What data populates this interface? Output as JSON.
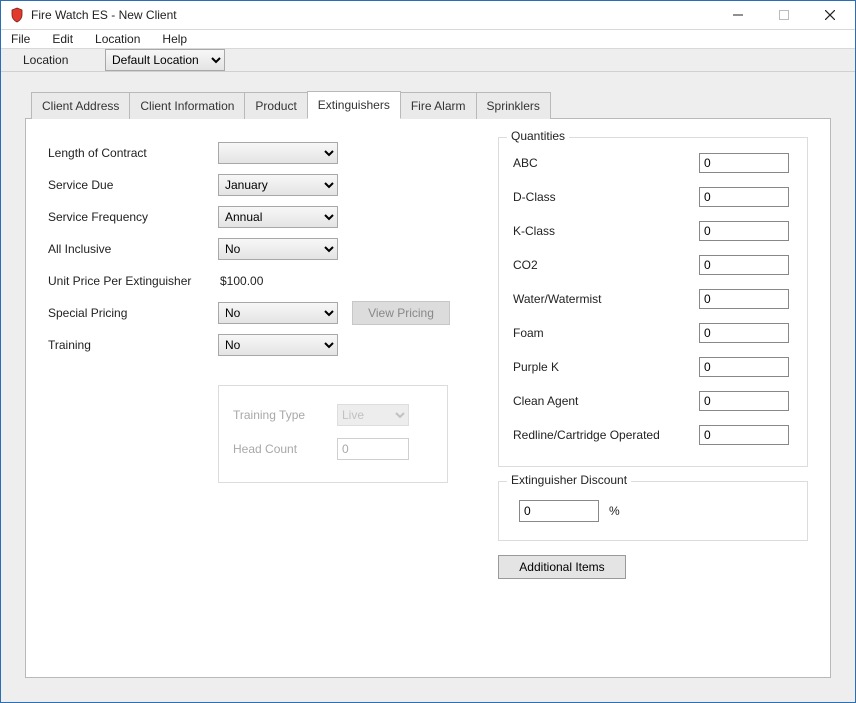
{
  "window": {
    "title": "Fire Watch ES - New Client"
  },
  "menubar": {
    "file": "File",
    "edit": "Edit",
    "location": "Location",
    "help": "Help"
  },
  "toolbar": {
    "location_label": "Location",
    "location_value": "Default Location"
  },
  "tabs": {
    "client_address": "Client Address",
    "client_information": "Client Information",
    "product": "Product",
    "extinguishers": "Extinguishers",
    "fire_alarm": "Fire Alarm",
    "sprinklers": "Sprinklers"
  },
  "form": {
    "length_of_contract": {
      "label": "Length of Contract",
      "value": ""
    },
    "service_due": {
      "label": "Service Due",
      "value": "January"
    },
    "service_frequency": {
      "label": "Service Frequency",
      "value": "Annual"
    },
    "all_inclusive": {
      "label": "All Inclusive",
      "value": "No"
    },
    "unit_price": {
      "label": "Unit Price Per Extinguisher",
      "value": "$100.00"
    },
    "special_pricing": {
      "label": "Special Pricing",
      "value": "No"
    },
    "view_pricing_label": "View Pricing",
    "training": {
      "label": "Training",
      "value": "No"
    },
    "training_box": {
      "training_type_label": "Training Type",
      "training_type_value": "Live",
      "head_count_label": "Head Count",
      "head_count_value": "0"
    }
  },
  "quantities": {
    "legend": "Quantities",
    "rows": [
      {
        "label": "ABC",
        "value": "0"
      },
      {
        "label": "D-Class",
        "value": "0"
      },
      {
        "label": "K-Class",
        "value": "0"
      },
      {
        "label": "CO2",
        "value": "0"
      },
      {
        "label": "Water/Watermist",
        "value": "0"
      },
      {
        "label": "Foam",
        "value": "0"
      },
      {
        "label": "Purple K",
        "value": "0"
      },
      {
        "label": "Clean Agent",
        "value": "0"
      },
      {
        "label": "Redline/Cartridge Operated",
        "value": "0"
      }
    ]
  },
  "discount": {
    "legend": "Extinguisher Discount",
    "value": "0",
    "unit": "%"
  },
  "buttons": {
    "additional_items": "Additional Items"
  }
}
